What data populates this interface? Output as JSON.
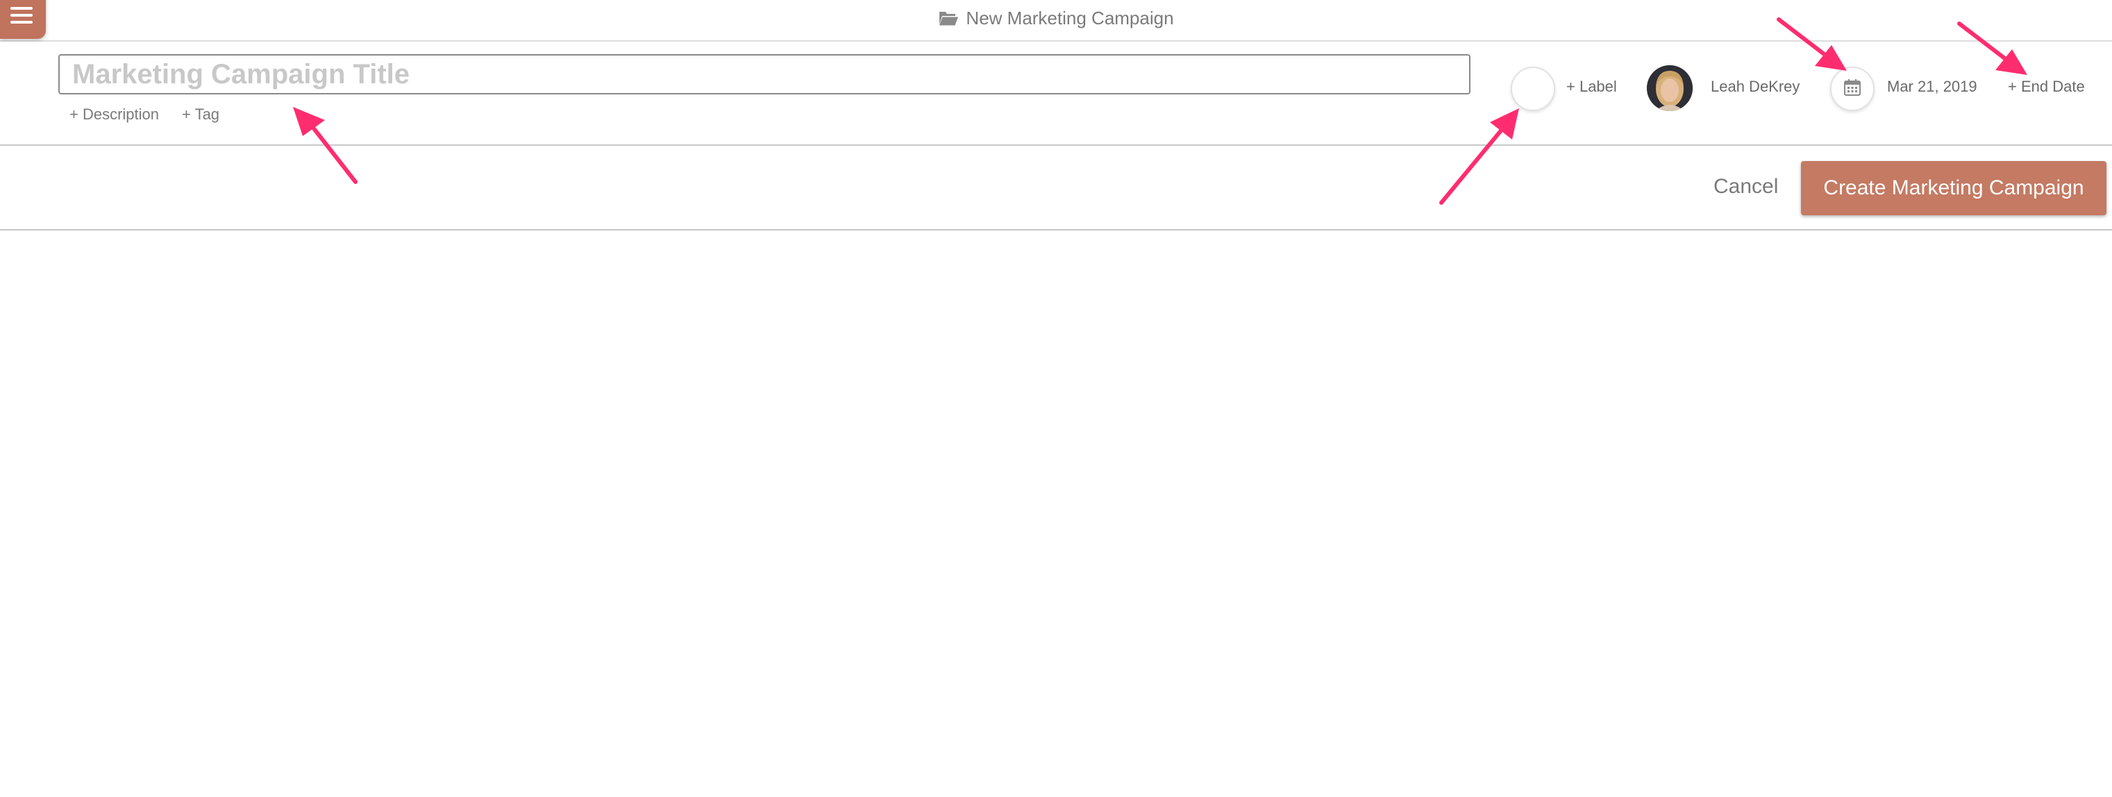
{
  "header": {
    "title": "New Marketing Campaign",
    "folder_icon": "folder-open-icon",
    "menu_icon": "hamburger-menu-icon"
  },
  "form": {
    "title_placeholder": "Marketing Campaign Title",
    "title_value": "",
    "description_link": "+ Description",
    "tag_link": "+ Tag",
    "label_link": "+ Label",
    "assignee_name": "Leah DeKrey",
    "start_date": "Mar 21, 2019",
    "end_date_link": "+ End Date",
    "calendar_icon": "calendar-icon"
  },
  "actions": {
    "cancel_label": "Cancel",
    "create_label": "Create Marketing Campaign"
  },
  "colors": {
    "accent": "#c47a63",
    "menu_button": "#c0735d",
    "annotation_arrow": "#ff2d6f",
    "muted_text": "#7a7a7a"
  }
}
